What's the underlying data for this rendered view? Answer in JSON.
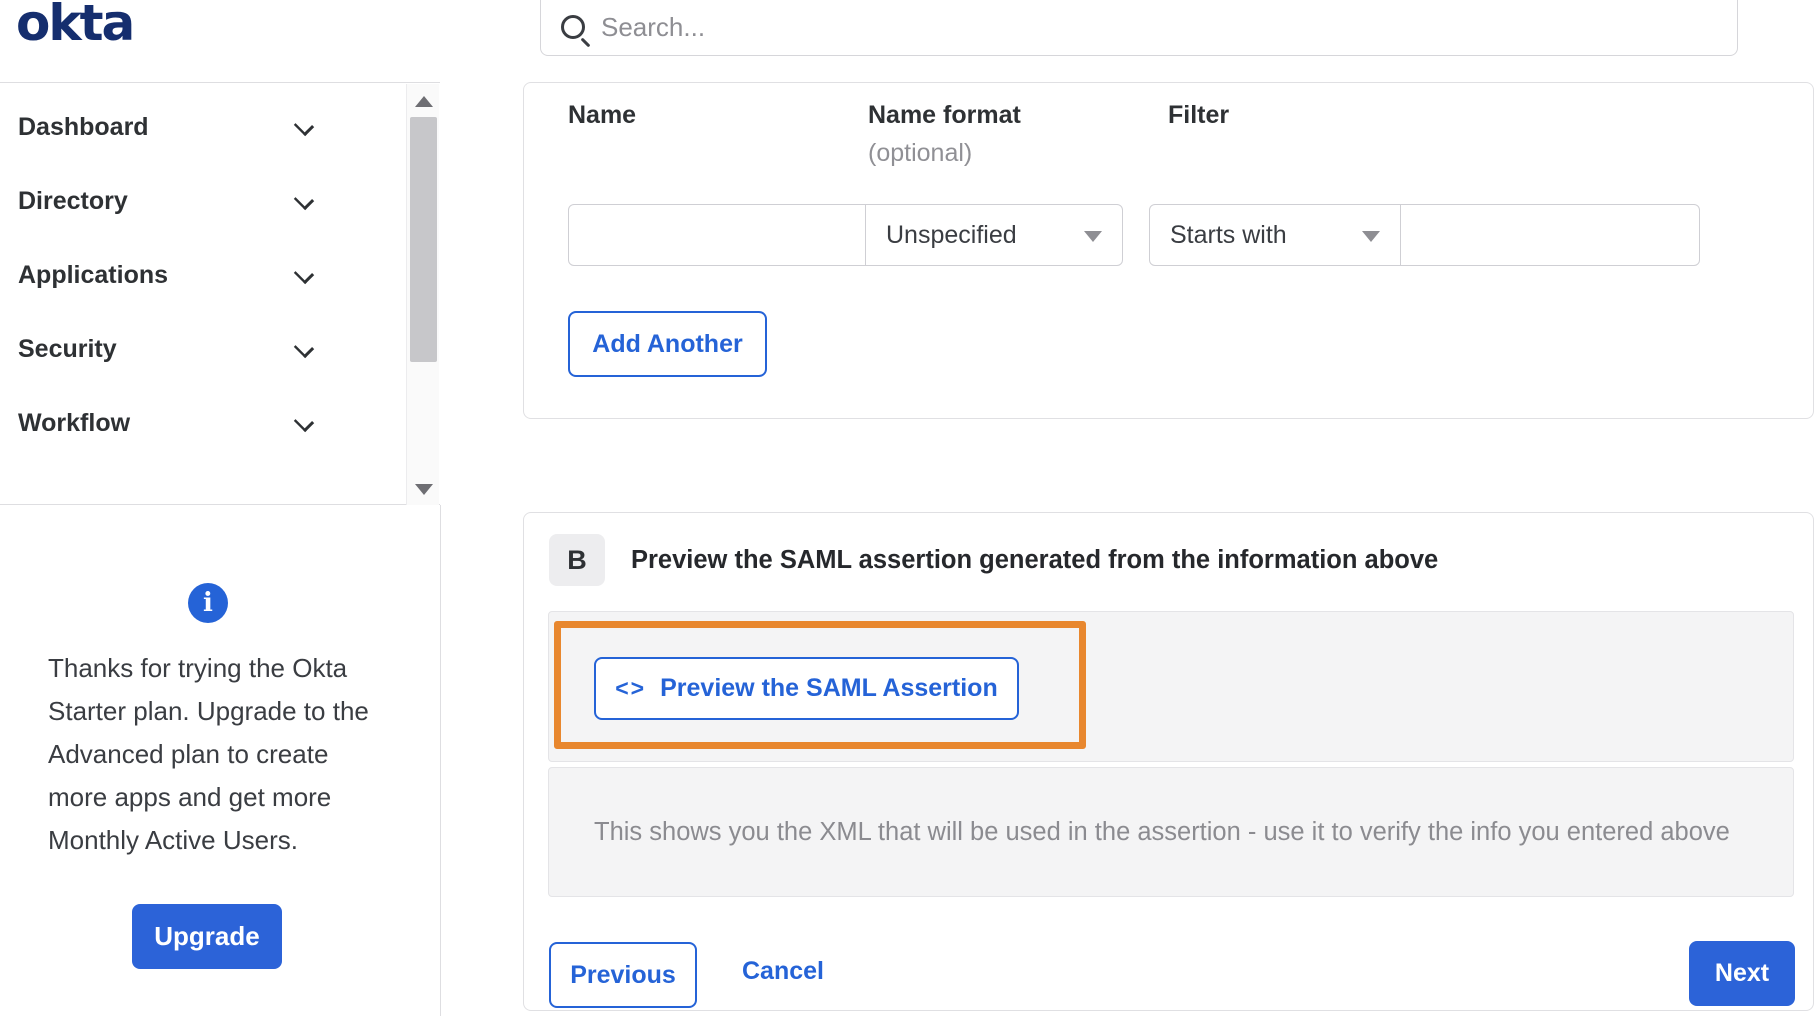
{
  "brand": {
    "logo_text": "okta"
  },
  "search": {
    "placeholder": "Search..."
  },
  "sidebar": {
    "items": [
      {
        "label": "Dashboard"
      },
      {
        "label": "Directory"
      },
      {
        "label": "Applications"
      },
      {
        "label": "Security"
      },
      {
        "label": "Workflow"
      }
    ],
    "upsell": {
      "message": "Thanks for trying the Okta Starter plan. Upgrade to the Advanced plan to create more apps and get more Monthly Active Users.",
      "upgrade_label": "Upgrade"
    }
  },
  "attribute_form": {
    "columns": {
      "name_label": "Name",
      "name_format_label": "Name format",
      "name_format_sublabel": "(optional)",
      "filter_label": "Filter"
    },
    "row": {
      "name_value": "",
      "name_format_value": "Unspecified",
      "filter_type_value": "Starts with",
      "filter_value": ""
    },
    "add_another_label": "Add Another"
  },
  "preview_section": {
    "badge": "B",
    "title": "Preview the SAML assertion generated from the information above",
    "preview_button_icon_glyph": "<>",
    "preview_button_label": "Preview the SAML Assertion",
    "helper_text": "This shows you the XML that will be used in the assertion - use it to verify the info you entered above"
  },
  "footer": {
    "previous_label": "Previous",
    "cancel_label": "Cancel",
    "next_label": "Next"
  },
  "icons": {
    "info_glyph": "i"
  },
  "colors": {
    "logo_navy": "#152e6e",
    "accent_blue": "#2563d7",
    "filled_blue": "#2c63d8",
    "highlight_orange": "#e8872e",
    "panel_gray": "#f4f4f5",
    "muted_text": "#8b8b90"
  }
}
